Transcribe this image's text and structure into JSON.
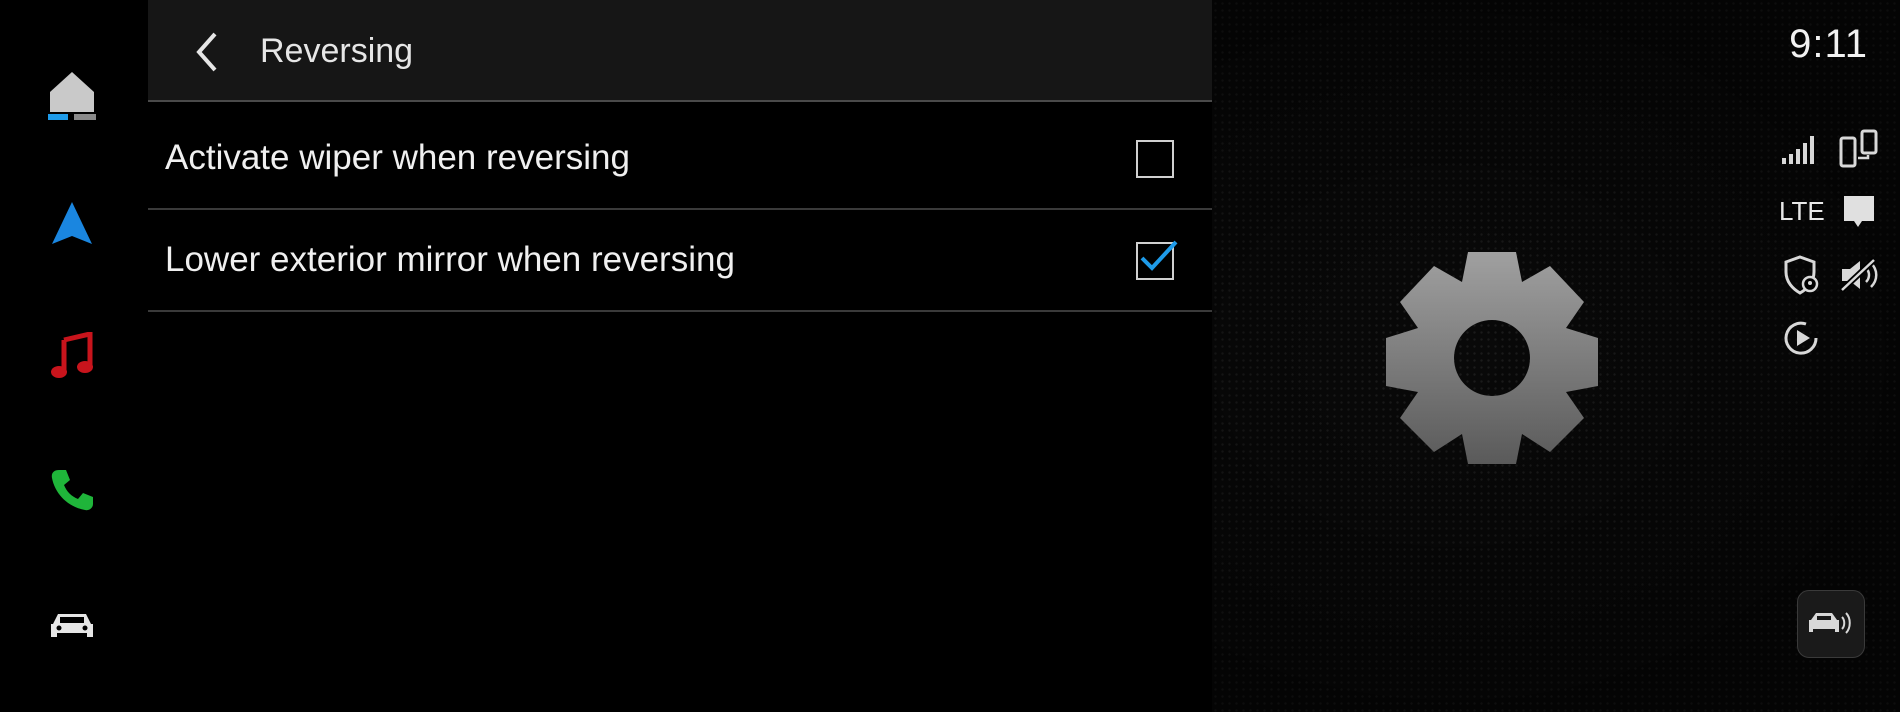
{
  "status_bar": {
    "time": "9:11",
    "network_label": "LTE"
  },
  "header": {
    "title": "Reversing"
  },
  "settings": [
    {
      "label": "Activate wiper when reversing",
      "checked": false
    },
    {
      "label": "Lower exterior mirror when reversing",
      "checked": true
    }
  ],
  "colors": {
    "accent": "#1e9be9",
    "nav_blue": "#1a86e0",
    "music_red": "#c8141c",
    "phone_green": "#1fb53a"
  },
  "icons": {
    "sidebar": [
      "home-icon",
      "navigation-icon",
      "music-icon",
      "phone-icon",
      "car-icon"
    ],
    "status": [
      "signal-icon",
      "phone-connection-icon",
      "message-icon",
      "privacy-location-icon",
      "mute-icon",
      "play-icon"
    ]
  }
}
